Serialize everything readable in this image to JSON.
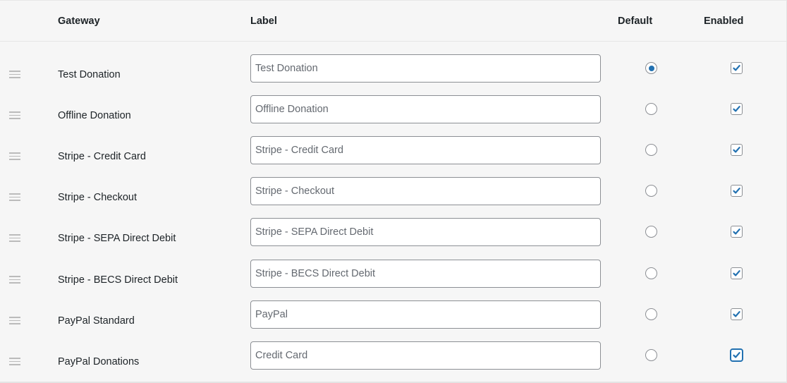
{
  "table": {
    "headers": {
      "gateway": "Gateway",
      "label": "Label",
      "default": "Default",
      "enabled": "Enabled"
    },
    "rows": [
      {
        "gateway": "Test Donation",
        "label": "Test Donation",
        "default": true,
        "enabled": true,
        "focused": false
      },
      {
        "gateway": "Offline Donation",
        "label": "Offline Donation",
        "default": false,
        "enabled": true,
        "focused": false
      },
      {
        "gateway": "Stripe - Credit Card",
        "label": "Stripe - Credit Card",
        "default": false,
        "enabled": true,
        "focused": false
      },
      {
        "gateway": "Stripe - Checkout",
        "label": "Stripe - Checkout",
        "default": false,
        "enabled": true,
        "focused": false
      },
      {
        "gateway": "Stripe - SEPA Direct Debit",
        "label": "Stripe - SEPA Direct Debit",
        "default": false,
        "enabled": true,
        "focused": false
      },
      {
        "gateway": "Stripe - BECS Direct Debit",
        "label": "Stripe - BECS Direct Debit",
        "default": false,
        "enabled": true,
        "focused": false
      },
      {
        "gateway": "PayPal Standard",
        "label": "PayPal",
        "default": false,
        "enabled": true,
        "focused": false
      },
      {
        "gateway": "PayPal Donations",
        "label": "Credit Card",
        "default": false,
        "enabled": true,
        "focused": true
      }
    ]
  },
  "icons": {
    "drag_handle": "drag-handle-icon",
    "checkmark": "checkmark-icon"
  },
  "colors": {
    "accent": "#2271b1",
    "background": "#f6f6f6",
    "input_border": "#8c8f94",
    "input_text": "#646970"
  }
}
